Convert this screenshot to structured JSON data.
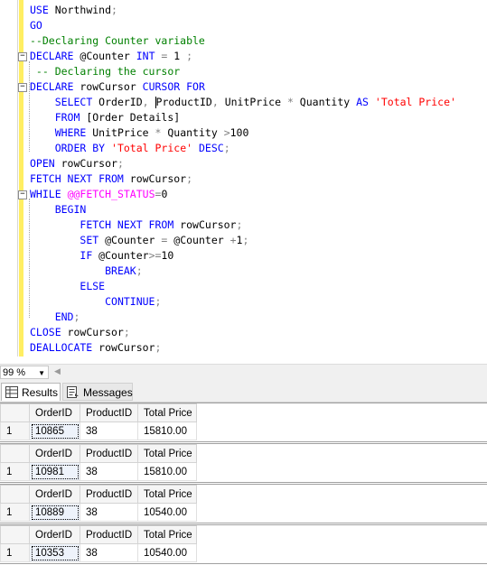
{
  "editor": {
    "lines": [
      [
        {
          "t": "USE",
          "c": "kw"
        },
        {
          "t": " Northwind",
          "c": ""
        },
        {
          "t": ";",
          "c": "op"
        }
      ],
      [
        {
          "t": "GO",
          "c": "kw"
        }
      ],
      [
        {
          "t": "--Declaring Counter variable",
          "c": "cm"
        }
      ],
      [
        {
          "t": "DECLARE",
          "c": "kw"
        },
        {
          "t": " @Counter ",
          "c": ""
        },
        {
          "t": "INT",
          "c": "kw"
        },
        {
          "t": " = ",
          "c": "op"
        },
        {
          "t": "1 ",
          "c": ""
        },
        {
          "t": ";",
          "c": "op"
        }
      ],
      [
        {
          "t": " -- Declaring the cursor",
          "c": "cm"
        }
      ],
      [
        {
          "t": "DECLARE",
          "c": "kw"
        },
        {
          "t": " rowCursor ",
          "c": ""
        },
        {
          "t": "CURSOR FOR",
          "c": "kw"
        }
      ],
      [
        {
          "t": "    ",
          "c": ""
        },
        {
          "t": "SELECT",
          "c": "kw"
        },
        {
          "t": " OrderID",
          "c": ""
        },
        {
          "t": ",",
          "c": "op"
        },
        {
          "t": " ",
          "c": ""
        },
        {
          "t": "|caret|",
          "c": "caret"
        },
        {
          "t": "ProductID",
          "c": ""
        },
        {
          "t": ",",
          "c": "op"
        },
        {
          "t": " UnitPrice ",
          "c": ""
        },
        {
          "t": "*",
          "c": "op"
        },
        {
          "t": " Quantity ",
          "c": ""
        },
        {
          "t": "AS",
          "c": "kw"
        },
        {
          "t": " ",
          "c": ""
        },
        {
          "t": "'Total Price'",
          "c": "str"
        }
      ],
      [
        {
          "t": "    ",
          "c": ""
        },
        {
          "t": "FROM",
          "c": "kw"
        },
        {
          "t": " [Order Details]",
          "c": ""
        }
      ],
      [
        {
          "t": "    ",
          "c": ""
        },
        {
          "t": "WHERE",
          "c": "kw"
        },
        {
          "t": " UnitPrice ",
          "c": ""
        },
        {
          "t": "*",
          "c": "op"
        },
        {
          "t": " Quantity ",
          "c": ""
        },
        {
          "t": ">",
          "c": "op"
        },
        {
          "t": "100",
          "c": ""
        }
      ],
      [
        {
          "t": "    ",
          "c": ""
        },
        {
          "t": "ORDER BY",
          "c": "kw"
        },
        {
          "t": " ",
          "c": ""
        },
        {
          "t": "'Total Price'",
          "c": "str"
        },
        {
          "t": " ",
          "c": ""
        },
        {
          "t": "DESC",
          "c": "kw"
        },
        {
          "t": ";",
          "c": "op"
        }
      ],
      [
        {
          "t": "OPEN",
          "c": "kw"
        },
        {
          "t": " rowCursor",
          "c": ""
        },
        {
          "t": ";",
          "c": "op"
        }
      ],
      [
        {
          "t": "FETCH NEXT FROM",
          "c": "kw"
        },
        {
          "t": " rowCursor",
          "c": ""
        },
        {
          "t": ";",
          "c": "op"
        }
      ],
      [
        {
          "t": "WHILE",
          "c": "kw"
        },
        {
          "t": " ",
          "c": ""
        },
        {
          "t": "@@FETCH_STATUS",
          "c": "fn"
        },
        {
          "t": "=",
          "c": "op"
        },
        {
          "t": "0",
          "c": ""
        }
      ],
      [
        {
          "t": "    ",
          "c": ""
        },
        {
          "t": "BEGIN",
          "c": "kw"
        }
      ],
      [
        {
          "t": "        ",
          "c": ""
        },
        {
          "t": "FETCH NEXT FROM",
          "c": "kw"
        },
        {
          "t": " rowCursor",
          "c": ""
        },
        {
          "t": ";",
          "c": "op"
        }
      ],
      [
        {
          "t": "        ",
          "c": ""
        },
        {
          "t": "SET",
          "c": "kw"
        },
        {
          "t": " @Counter ",
          "c": ""
        },
        {
          "t": "=",
          "c": "op"
        },
        {
          "t": " @Counter ",
          "c": ""
        },
        {
          "t": "+",
          "c": "op"
        },
        {
          "t": "1",
          "c": ""
        },
        {
          "t": ";",
          "c": "op"
        }
      ],
      [
        {
          "t": "        ",
          "c": ""
        },
        {
          "t": "IF",
          "c": "kw"
        },
        {
          "t": " @Counter",
          "c": ""
        },
        {
          "t": ">=",
          "c": "op"
        },
        {
          "t": "10",
          "c": ""
        }
      ],
      [
        {
          "t": "            ",
          "c": ""
        },
        {
          "t": "BREAK",
          "c": "kw"
        },
        {
          "t": ";",
          "c": "op"
        }
      ],
      [
        {
          "t": "        ",
          "c": ""
        },
        {
          "t": "ELSE",
          "c": "kw"
        }
      ],
      [
        {
          "t": "            ",
          "c": ""
        },
        {
          "t": "CONTINUE",
          "c": "kw"
        },
        {
          "t": ";",
          "c": "op"
        }
      ],
      [
        {
          "t": "    ",
          "c": ""
        },
        {
          "t": "END",
          "c": "kw"
        },
        {
          "t": ";",
          "c": "op"
        }
      ],
      [
        {
          "t": "CLOSE",
          "c": "kw"
        },
        {
          "t": " rowCursor",
          "c": ""
        },
        {
          "t": ";",
          "c": "op"
        }
      ],
      [
        {
          "t": "DEALLOCATE",
          "c": "kw"
        },
        {
          "t": " rowCursor",
          "c": ""
        },
        {
          "t": ";",
          "c": "op"
        }
      ]
    ]
  },
  "zoom": {
    "value": "99 %"
  },
  "tabs": {
    "results_label": "Results",
    "messages_label": "Messages"
  },
  "results": {
    "columns": [
      "OrderID",
      "ProductID",
      "Total Price"
    ],
    "grids": [
      {
        "row": "1",
        "cells": [
          "10865",
          "38",
          "15810.00"
        ]
      },
      {
        "row": "1",
        "cells": [
          "10981",
          "38",
          "15810.00"
        ]
      },
      {
        "row": "1",
        "cells": [
          "10889",
          "38",
          "10540.00"
        ]
      },
      {
        "row": "1",
        "cells": [
          "10353",
          "38",
          "10540.00"
        ]
      }
    ]
  },
  "colors": {
    "keyword": "#0000ff",
    "comment": "#008000",
    "string": "#ff0000",
    "system_fn": "#ff00ff",
    "operator": "#808080"
  }
}
